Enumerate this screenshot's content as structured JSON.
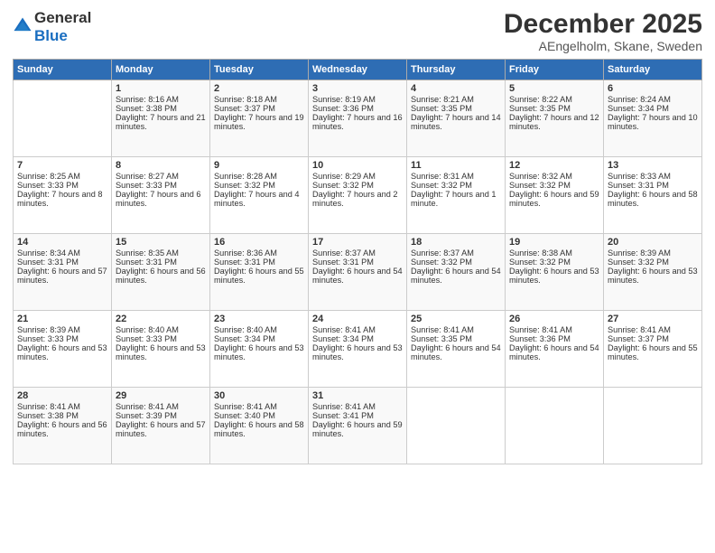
{
  "header": {
    "logo_general": "General",
    "logo_blue": "Blue",
    "month": "December 2025",
    "location": "AEngelholm, Skane, Sweden"
  },
  "days_of_week": [
    "Sunday",
    "Monday",
    "Tuesday",
    "Wednesday",
    "Thursday",
    "Friday",
    "Saturday"
  ],
  "weeks": [
    [
      {
        "day": "",
        "sunrise": "",
        "sunset": "",
        "daylight": ""
      },
      {
        "day": "1",
        "sunrise": "Sunrise: 8:16 AM",
        "sunset": "Sunset: 3:38 PM",
        "daylight": "Daylight: 7 hours and 21 minutes."
      },
      {
        "day": "2",
        "sunrise": "Sunrise: 8:18 AM",
        "sunset": "Sunset: 3:37 PM",
        "daylight": "Daylight: 7 hours and 19 minutes."
      },
      {
        "day": "3",
        "sunrise": "Sunrise: 8:19 AM",
        "sunset": "Sunset: 3:36 PM",
        "daylight": "Daylight: 7 hours and 16 minutes."
      },
      {
        "day": "4",
        "sunrise": "Sunrise: 8:21 AM",
        "sunset": "Sunset: 3:35 PM",
        "daylight": "Daylight: 7 hours and 14 minutes."
      },
      {
        "day": "5",
        "sunrise": "Sunrise: 8:22 AM",
        "sunset": "Sunset: 3:35 PM",
        "daylight": "Daylight: 7 hours and 12 minutes."
      },
      {
        "day": "6",
        "sunrise": "Sunrise: 8:24 AM",
        "sunset": "Sunset: 3:34 PM",
        "daylight": "Daylight: 7 hours and 10 minutes."
      }
    ],
    [
      {
        "day": "7",
        "sunrise": "Sunrise: 8:25 AM",
        "sunset": "Sunset: 3:33 PM",
        "daylight": "Daylight: 7 hours and 8 minutes."
      },
      {
        "day": "8",
        "sunrise": "Sunrise: 8:27 AM",
        "sunset": "Sunset: 3:33 PM",
        "daylight": "Daylight: 7 hours and 6 minutes."
      },
      {
        "day": "9",
        "sunrise": "Sunrise: 8:28 AM",
        "sunset": "Sunset: 3:32 PM",
        "daylight": "Daylight: 7 hours and 4 minutes."
      },
      {
        "day": "10",
        "sunrise": "Sunrise: 8:29 AM",
        "sunset": "Sunset: 3:32 PM",
        "daylight": "Daylight: 7 hours and 2 minutes."
      },
      {
        "day": "11",
        "sunrise": "Sunrise: 8:31 AM",
        "sunset": "Sunset: 3:32 PM",
        "daylight": "Daylight: 7 hours and 1 minute."
      },
      {
        "day": "12",
        "sunrise": "Sunrise: 8:32 AM",
        "sunset": "Sunset: 3:32 PM",
        "daylight": "Daylight: 6 hours and 59 minutes."
      },
      {
        "day": "13",
        "sunrise": "Sunrise: 8:33 AM",
        "sunset": "Sunset: 3:31 PM",
        "daylight": "Daylight: 6 hours and 58 minutes."
      }
    ],
    [
      {
        "day": "14",
        "sunrise": "Sunrise: 8:34 AM",
        "sunset": "Sunset: 3:31 PM",
        "daylight": "Daylight: 6 hours and 57 minutes."
      },
      {
        "day": "15",
        "sunrise": "Sunrise: 8:35 AM",
        "sunset": "Sunset: 3:31 PM",
        "daylight": "Daylight: 6 hours and 56 minutes."
      },
      {
        "day": "16",
        "sunrise": "Sunrise: 8:36 AM",
        "sunset": "Sunset: 3:31 PM",
        "daylight": "Daylight: 6 hours and 55 minutes."
      },
      {
        "day": "17",
        "sunrise": "Sunrise: 8:37 AM",
        "sunset": "Sunset: 3:31 PM",
        "daylight": "Daylight: 6 hours and 54 minutes."
      },
      {
        "day": "18",
        "sunrise": "Sunrise: 8:37 AM",
        "sunset": "Sunset: 3:32 PM",
        "daylight": "Daylight: 6 hours and 54 minutes."
      },
      {
        "day": "19",
        "sunrise": "Sunrise: 8:38 AM",
        "sunset": "Sunset: 3:32 PM",
        "daylight": "Daylight: 6 hours and 53 minutes."
      },
      {
        "day": "20",
        "sunrise": "Sunrise: 8:39 AM",
        "sunset": "Sunset: 3:32 PM",
        "daylight": "Daylight: 6 hours and 53 minutes."
      }
    ],
    [
      {
        "day": "21",
        "sunrise": "Sunrise: 8:39 AM",
        "sunset": "Sunset: 3:33 PM",
        "daylight": "Daylight: 6 hours and 53 minutes."
      },
      {
        "day": "22",
        "sunrise": "Sunrise: 8:40 AM",
        "sunset": "Sunset: 3:33 PM",
        "daylight": "Daylight: 6 hours and 53 minutes."
      },
      {
        "day": "23",
        "sunrise": "Sunrise: 8:40 AM",
        "sunset": "Sunset: 3:34 PM",
        "daylight": "Daylight: 6 hours and 53 minutes."
      },
      {
        "day": "24",
        "sunrise": "Sunrise: 8:41 AM",
        "sunset": "Sunset: 3:34 PM",
        "daylight": "Daylight: 6 hours and 53 minutes."
      },
      {
        "day": "25",
        "sunrise": "Sunrise: 8:41 AM",
        "sunset": "Sunset: 3:35 PM",
        "daylight": "Daylight: 6 hours and 54 minutes."
      },
      {
        "day": "26",
        "sunrise": "Sunrise: 8:41 AM",
        "sunset": "Sunset: 3:36 PM",
        "daylight": "Daylight: 6 hours and 54 minutes."
      },
      {
        "day": "27",
        "sunrise": "Sunrise: 8:41 AM",
        "sunset": "Sunset: 3:37 PM",
        "daylight": "Daylight: 6 hours and 55 minutes."
      }
    ],
    [
      {
        "day": "28",
        "sunrise": "Sunrise: 8:41 AM",
        "sunset": "Sunset: 3:38 PM",
        "daylight": "Daylight: 6 hours and 56 minutes."
      },
      {
        "day": "29",
        "sunrise": "Sunrise: 8:41 AM",
        "sunset": "Sunset: 3:39 PM",
        "daylight": "Daylight: 6 hours and 57 minutes."
      },
      {
        "day": "30",
        "sunrise": "Sunrise: 8:41 AM",
        "sunset": "Sunset: 3:40 PM",
        "daylight": "Daylight: 6 hours and 58 minutes."
      },
      {
        "day": "31",
        "sunrise": "Sunrise: 8:41 AM",
        "sunset": "Sunset: 3:41 PM",
        "daylight": "Daylight: 6 hours and 59 minutes."
      },
      {
        "day": "",
        "sunrise": "",
        "sunset": "",
        "daylight": ""
      },
      {
        "day": "",
        "sunrise": "",
        "sunset": "",
        "daylight": ""
      },
      {
        "day": "",
        "sunrise": "",
        "sunset": "",
        "daylight": ""
      }
    ]
  ]
}
